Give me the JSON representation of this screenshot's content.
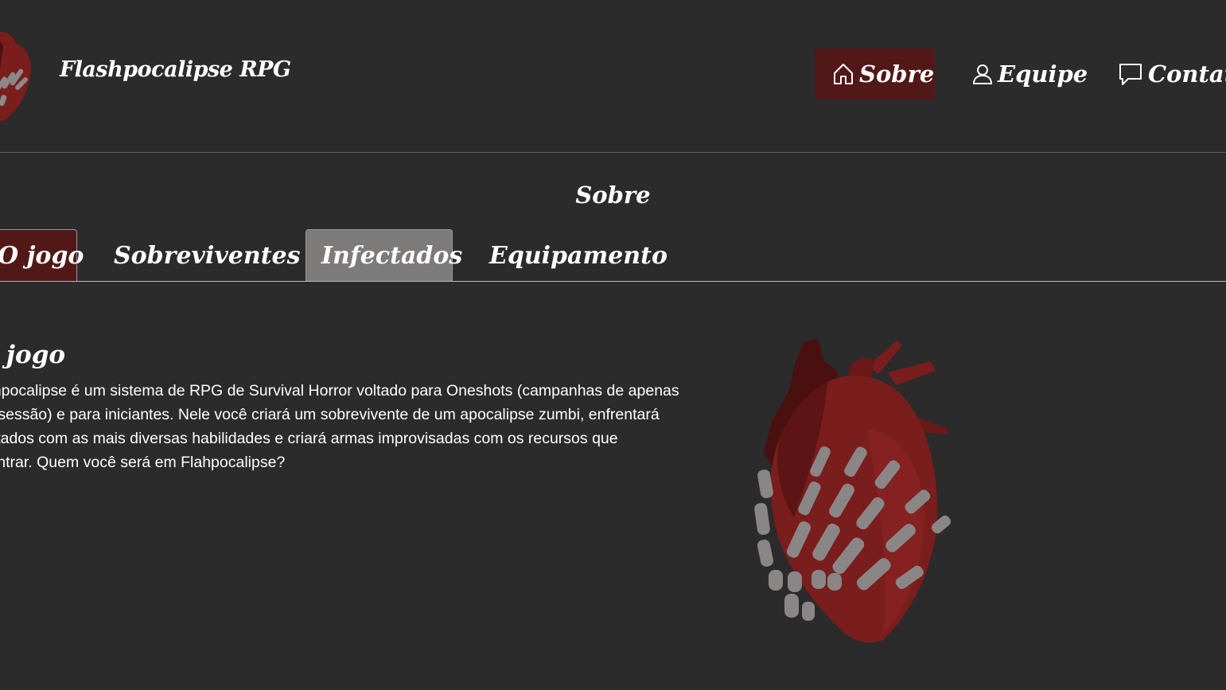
{
  "header": {
    "site_title": "Flashpocalipse RPG",
    "nav": [
      {
        "label": "Sobre",
        "icon": "home-icon",
        "active": true
      },
      {
        "label": "Equipe",
        "icon": "user-icon"
      },
      {
        "label": "Contato",
        "icon": "chat-bubble-icon"
      }
    ]
  },
  "main": {
    "section_title": "Sobre",
    "tabs": [
      {
        "label": "O jogo",
        "state": "active"
      },
      {
        "label": "Sobreviventes"
      },
      {
        "label": "Infectados",
        "state": "hover"
      },
      {
        "label": "Equipamento"
      }
    ],
    "content": {
      "heading": "O jogo",
      "lines": [
        "Flashpocalipse é um sistema de RPG de Survival Horror voltado para Oneshots (campanhas de apenas",
        "uma sessão) e para iniciantes. Nele você criará um sobrevivente de um apocalipse zumbi, enfrentará",
        "infectados com as mais diversas habilidades e criará armas improvisadas com os recursos que",
        "encontrar. Quem você será em Flahpocalipse?"
      ]
    },
    "illustration": {
      "icon": "heart-skeleton-hand-illustration"
    }
  },
  "colors": {
    "background": "#2b2b2b",
    "accent": "#521717",
    "tab_hover": "#7d7a7a",
    "text": "#ffffff"
  }
}
